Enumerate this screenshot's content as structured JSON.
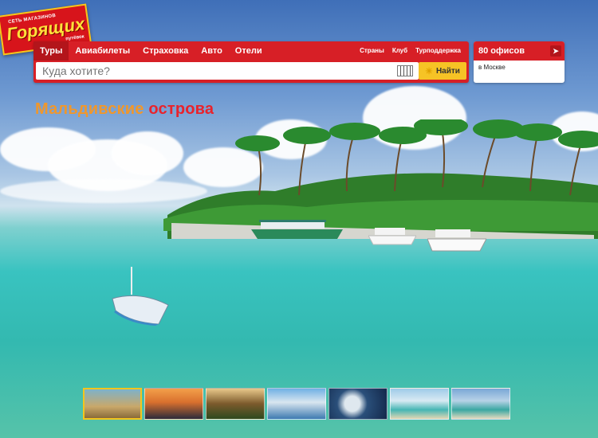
{
  "logo": {
    "small_top": "СЕТЬ МАГАЗИНОВ",
    "big": "Горящих",
    "small_bottom": "путёвок"
  },
  "tabs": [
    {
      "label": "Туры",
      "active": true
    },
    {
      "label": "Авиабилеты",
      "active": false
    },
    {
      "label": "Страховка",
      "active": false
    },
    {
      "label": "Авто",
      "active": false
    },
    {
      "label": "Отели",
      "active": false
    }
  ],
  "links": [
    "Страны",
    "Клуб",
    "Турподдержка"
  ],
  "search": {
    "placeholder": "Куда хотите?",
    "button_label": "Найти"
  },
  "offices": {
    "title": "80 офисов",
    "city": "в Москве"
  },
  "hero": {
    "title_part1": "Мальдивские",
    "title_part2": "острова"
  },
  "thumbnails": [
    {
      "name": "thumb-1",
      "active": true
    },
    {
      "name": "thumb-2",
      "active": false
    },
    {
      "name": "thumb-3",
      "active": false
    },
    {
      "name": "thumb-4",
      "active": false
    },
    {
      "name": "thumb-5",
      "active": false
    },
    {
      "name": "thumb-6",
      "active": false
    },
    {
      "name": "thumb-7",
      "active": false
    }
  ],
  "colors": {
    "brand_red": "#d71f26",
    "accent_yellow": "#f6c325",
    "title_orange": "#f0972c",
    "title_red": "#e8232c"
  }
}
